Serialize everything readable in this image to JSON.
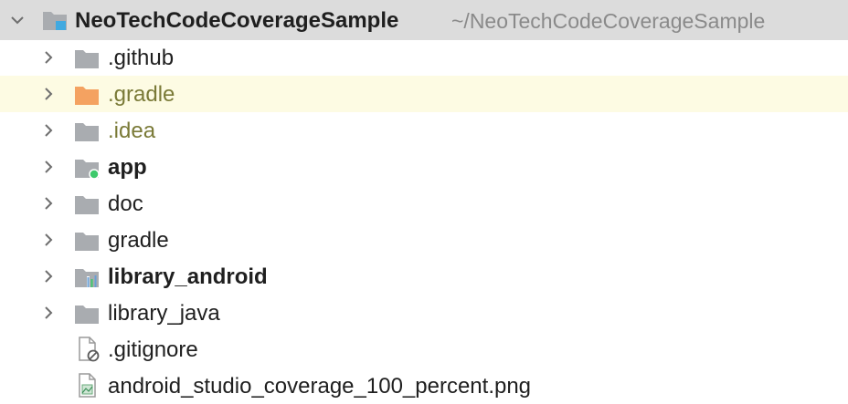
{
  "project": {
    "name": "NeoTechCodeCoverageSample",
    "path": "~/NeoTechCodeCoverageSample"
  },
  "items": [
    {
      "label": ".github",
      "type": "folder",
      "icon": "folder-icon"
    },
    {
      "label": ".gradle",
      "type": "folder",
      "icon": "folder-excluded-icon",
      "highlighted": true
    },
    {
      "label": ".idea",
      "type": "folder",
      "icon": "folder-icon"
    },
    {
      "label": "app",
      "type": "module",
      "icon": "module-folder-icon"
    },
    {
      "label": "doc",
      "type": "folder",
      "icon": "folder-icon"
    },
    {
      "label": "gradle",
      "type": "folder",
      "icon": "folder-icon"
    },
    {
      "label": "library_android",
      "type": "module",
      "icon": "library-module-icon"
    },
    {
      "label": "library_java",
      "type": "folder",
      "icon": "folder-icon"
    },
    {
      "label": ".gitignore",
      "type": "file",
      "icon": "ignored-file-icon"
    },
    {
      "label": "android_studio_coverage_100_percent.png",
      "type": "file",
      "icon": "image-file-icon"
    }
  ],
  "colors": {
    "root_row_bg": "#dcdcdc",
    "highlight_row_bg": "#fdfbe3",
    "folder_gray": "#a9acb0",
    "folder_orange": "#f4a261",
    "ignored_text": "#7a7a37",
    "module_dot": "#3dc96b",
    "path_text": "#8a8a8a"
  }
}
